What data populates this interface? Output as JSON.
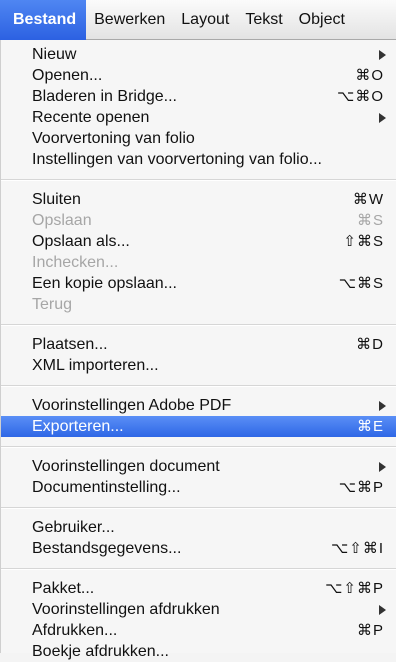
{
  "menubar": {
    "items": [
      "Bestand",
      "Bewerken",
      "Layout",
      "Tekst",
      "Object"
    ],
    "active_index": 0
  },
  "menu": {
    "sections": [
      [
        {
          "label": "Nieuw",
          "shortcut": "",
          "submenu": true,
          "enabled": true
        },
        {
          "label": "Openen...",
          "shortcut": "⌘O",
          "submenu": false,
          "enabled": true
        },
        {
          "label": "Bladeren in Bridge...",
          "shortcut": "⌥⌘O",
          "submenu": false,
          "enabled": true
        },
        {
          "label": "Recente openen",
          "shortcut": "",
          "submenu": true,
          "enabled": true
        },
        {
          "label": "Voorvertoning van folio",
          "shortcut": "",
          "submenu": false,
          "enabled": true
        },
        {
          "label": "Instellingen van voorvertoning van folio...",
          "shortcut": "",
          "submenu": false,
          "enabled": true
        }
      ],
      [
        {
          "label": "Sluiten",
          "shortcut": "⌘W",
          "submenu": false,
          "enabled": true
        },
        {
          "label": "Opslaan",
          "shortcut": "⌘S",
          "submenu": false,
          "enabled": false
        },
        {
          "label": "Opslaan als...",
          "shortcut": "⇧⌘S",
          "submenu": false,
          "enabled": true
        },
        {
          "label": "Inchecken...",
          "shortcut": "",
          "submenu": false,
          "enabled": false
        },
        {
          "label": "Een kopie opslaan...",
          "shortcut": "⌥⌘S",
          "submenu": false,
          "enabled": true
        },
        {
          "label": "Terug",
          "shortcut": "",
          "submenu": false,
          "enabled": false
        }
      ],
      [
        {
          "label": "Plaatsen...",
          "shortcut": "⌘D",
          "submenu": false,
          "enabled": true
        },
        {
          "label": "XML importeren...",
          "shortcut": "",
          "submenu": false,
          "enabled": true
        }
      ],
      [
        {
          "label": "Voorinstellingen Adobe PDF",
          "shortcut": "",
          "submenu": true,
          "enabled": true
        },
        {
          "label": "Exporteren...",
          "shortcut": "⌘E",
          "submenu": false,
          "enabled": true,
          "highlighted": true
        }
      ],
      [
        {
          "label": "Voorinstellingen document",
          "shortcut": "",
          "submenu": true,
          "enabled": true
        },
        {
          "label": "Documentinstelling...",
          "shortcut": "⌥⌘P",
          "submenu": false,
          "enabled": true
        }
      ],
      [
        {
          "label": "Gebruiker...",
          "shortcut": "",
          "submenu": false,
          "enabled": true
        },
        {
          "label": "Bestandsgegevens...",
          "shortcut": "⌥⇧⌘I",
          "submenu": false,
          "enabled": true
        }
      ],
      [
        {
          "label": "Pakket...",
          "shortcut": "⌥⇧⌘P",
          "submenu": false,
          "enabled": true
        },
        {
          "label": "Voorinstellingen afdrukken",
          "shortcut": "",
          "submenu": true,
          "enabled": true
        },
        {
          "label": "Afdrukken...",
          "shortcut": "⌘P",
          "submenu": false,
          "enabled": true
        },
        {
          "label": "Boekje afdrukken...",
          "shortcut": "",
          "submenu": false,
          "enabled": true
        }
      ]
    ]
  },
  "colors": {
    "highlight": "#2f67e6",
    "disabled_text": "#a6a6a6"
  }
}
